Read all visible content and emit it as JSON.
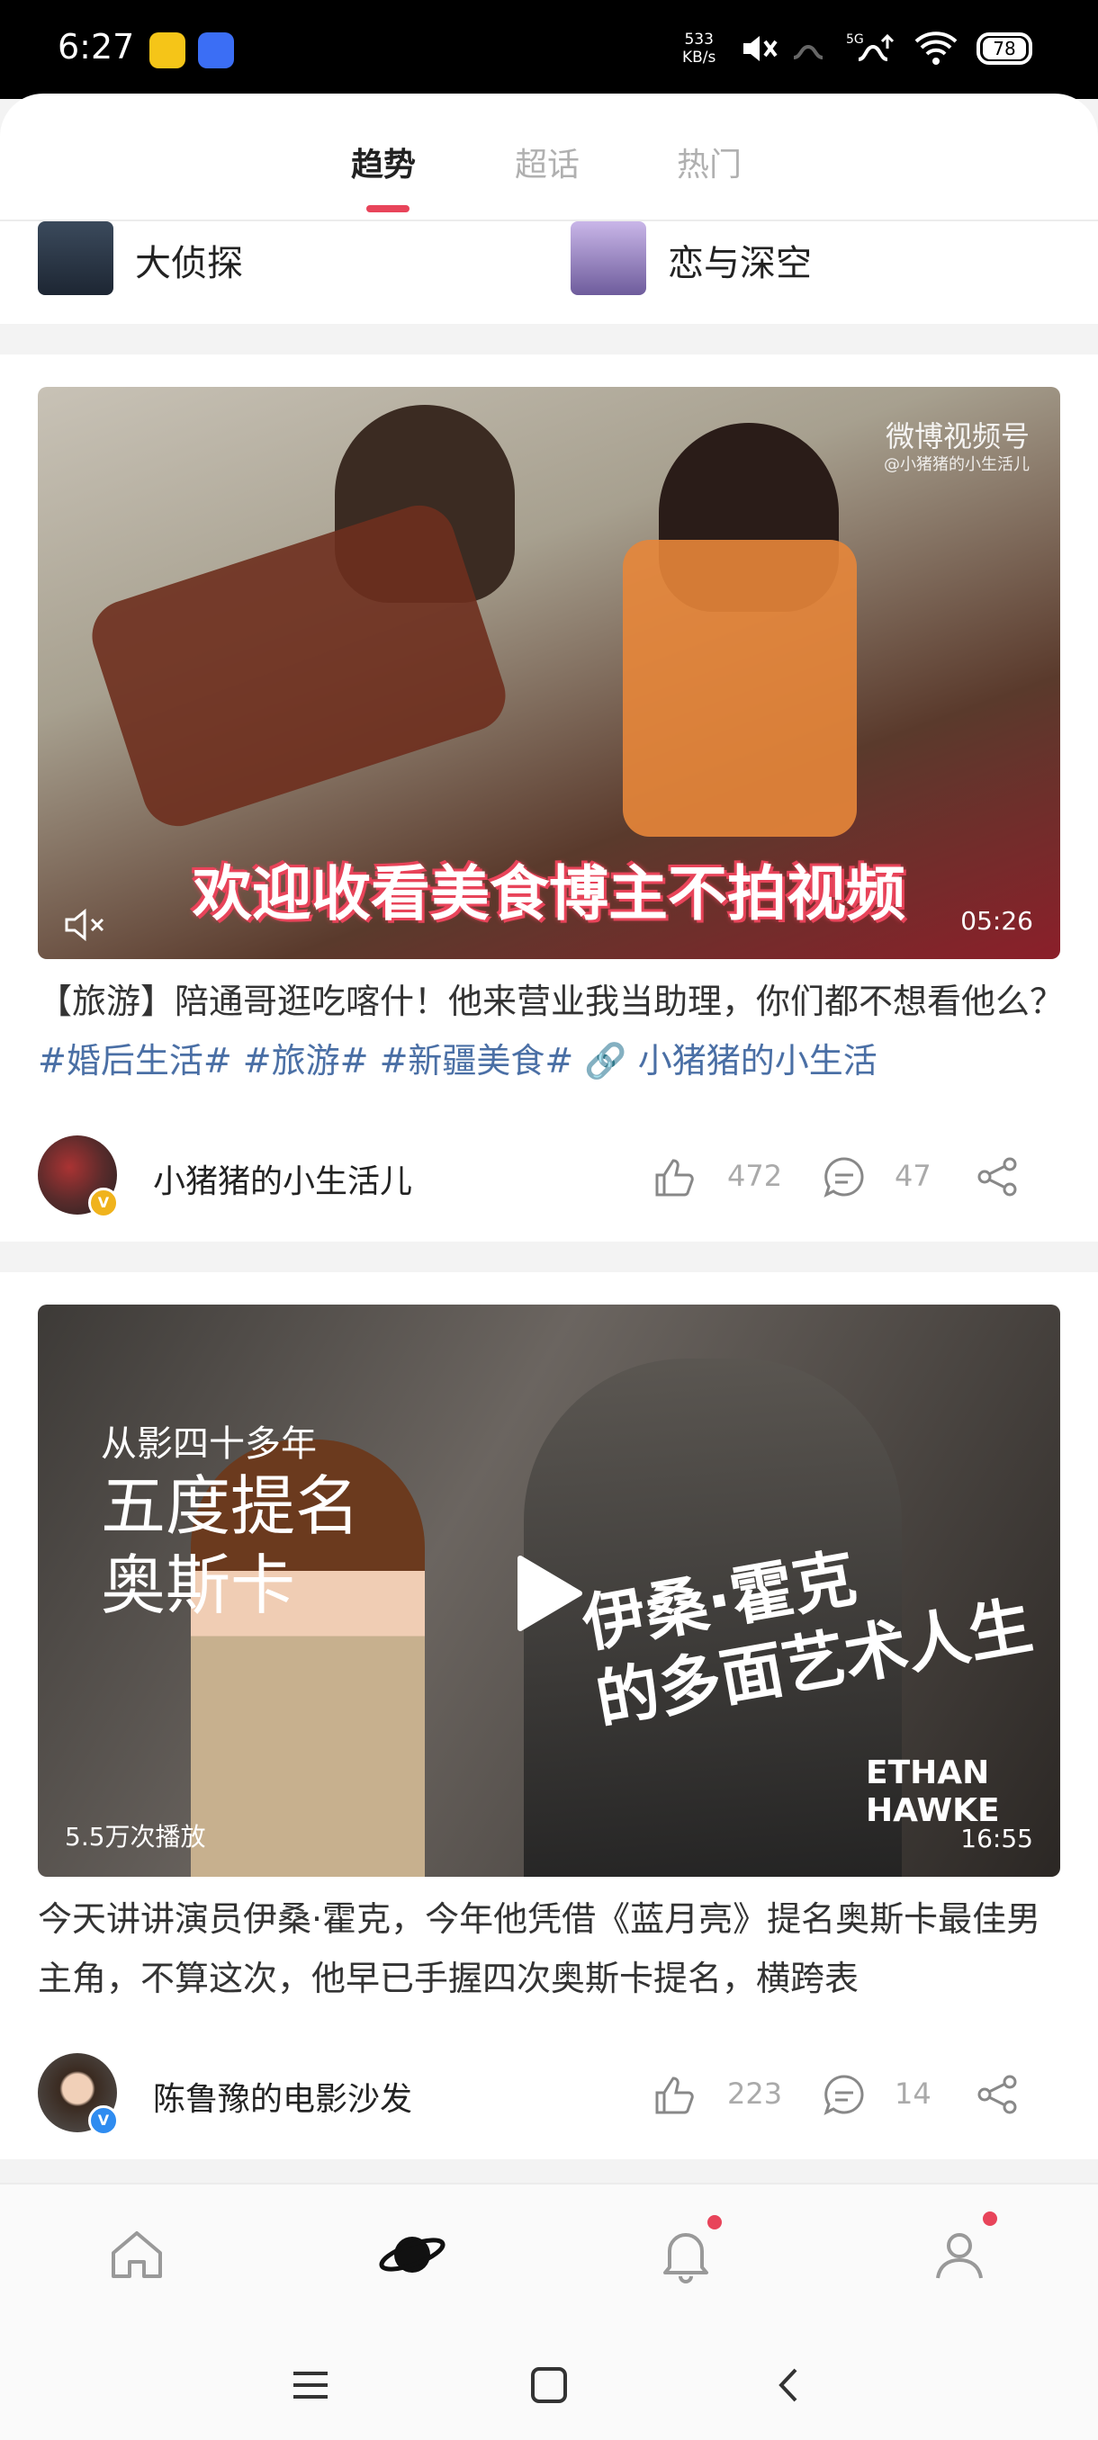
{
  "status_bar": {
    "time": "6:27",
    "net_speed_value": "533",
    "net_speed_unit": "KB/s",
    "network": "5G",
    "battery": "78"
  },
  "tabs": [
    "趋势",
    "超话",
    "热门"
  ],
  "active_tab": "趋势",
  "topics": [
    {
      "label": "大侦探"
    },
    {
      "label": "恋与深空"
    }
  ],
  "posts": [
    {
      "video_overlay_caption": "欢迎收看美食博主不拍视频",
      "watermark_brand": "微博视频号",
      "watermark_handle": "@小猪猪的小生活儿",
      "duration": "05:26",
      "text_prefix": "【旅游】陪通哥逛吃喀什！他来营业我当助理，你们都不想看他么？",
      "tags": [
        "#婚后生活#",
        "#旅游#",
        "#新疆美食#"
      ],
      "link_text": "小猪猪的小生活",
      "author": "小猪猪的小生活儿",
      "likes": "472",
      "comments": "47"
    },
    {
      "overlay_left_small": "从影四十多年",
      "overlay_left_line2": "五度提名",
      "overlay_left_line3": "奥斯卡",
      "overlay_title_line1": "伊桑·霍克",
      "overlay_title_line2": "的多面艺术人生",
      "overlay_en_line1": "ETHAN",
      "overlay_en_line2": "HAWKE",
      "play_count": "5.5万次播放",
      "duration": "16:55",
      "text": "今天讲讲演员伊桑·霍克，今年他凭借《蓝月亮》提名奥斯卡最佳男主角，不算这次，他早已手握四次奥斯卡提名，横跨表",
      "author": "陈鲁豫的电影沙发",
      "likes": "223",
      "comments": "14"
    }
  ],
  "colors": {
    "accent": "#e8445a",
    "link": "#4a6fa5",
    "verified_gold": "#f0b31c",
    "verified_blue": "#2f8cf0"
  },
  "icons": {
    "bottom_nav": [
      "home-icon",
      "discover-planet-icon",
      "notification-bell-icon",
      "profile-icon"
    ],
    "system_nav": [
      "menu-icon",
      "home-square-icon",
      "back-icon"
    ]
  }
}
